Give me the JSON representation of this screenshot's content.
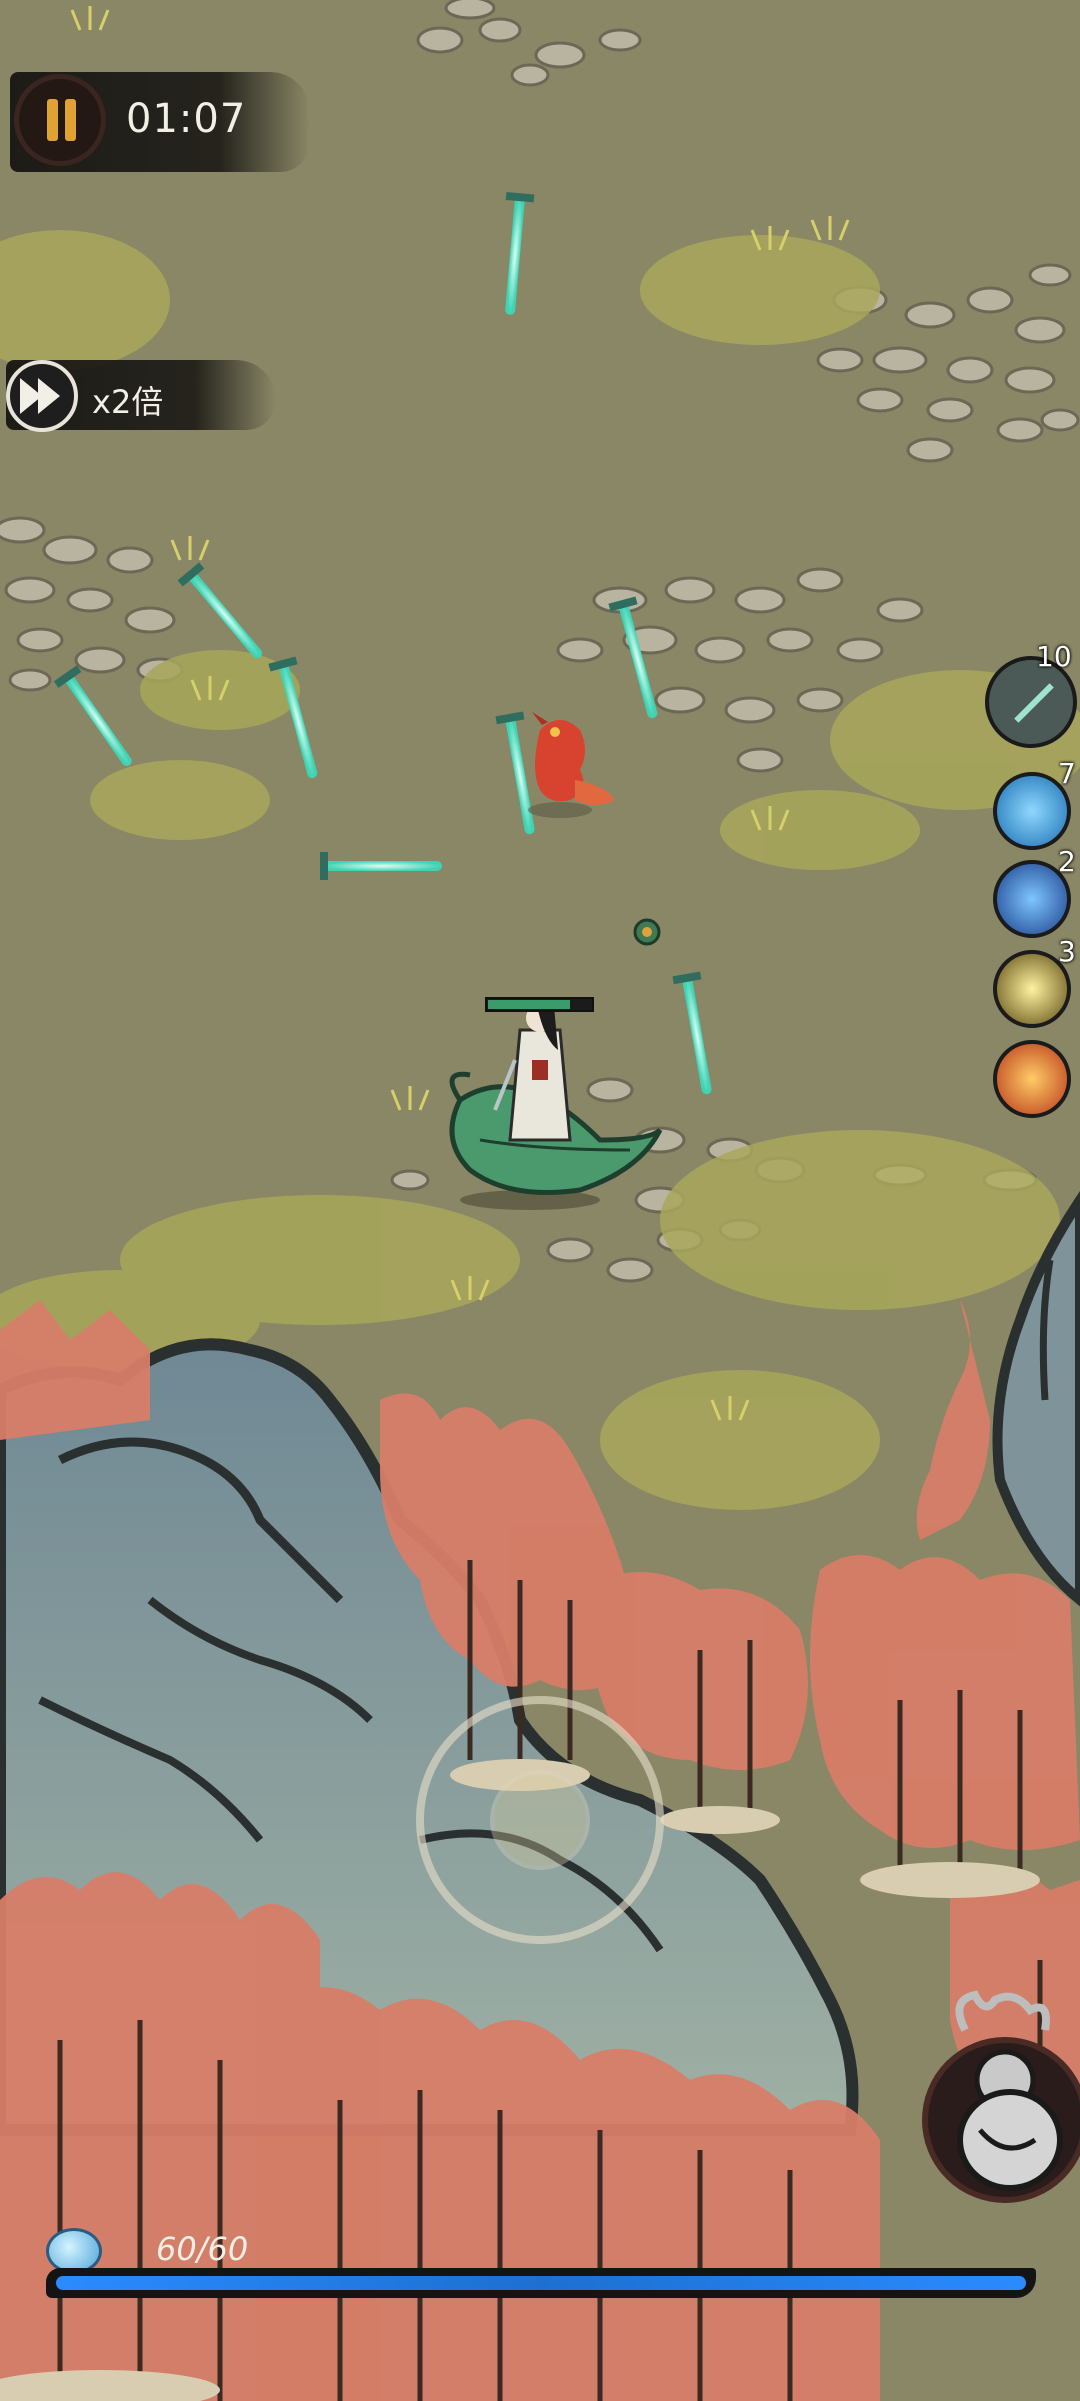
{
  "hud": {
    "timer": "01:07",
    "speed_label": "x2倍",
    "hp_text": "60/60",
    "player_health_fraction": 0.8,
    "xp_fraction": 1.0
  },
  "skills": [
    {
      "name": "sword-skill-icon",
      "count": "10"
    },
    {
      "name": "water-wave-skill-icon",
      "count": "7"
    },
    {
      "name": "ice-shard-skill-icon",
      "count": "2"
    },
    {
      "name": "lightning-skill-icon",
      "count": "3"
    },
    {
      "name": "fire-meteor-skill-icon",
      "count": ""
    }
  ],
  "colors": {
    "ground": "#8a8766",
    "xp_bar": "#1e6fd0",
    "health_bar": "#3a9c6a",
    "trees": "#d77d68"
  }
}
